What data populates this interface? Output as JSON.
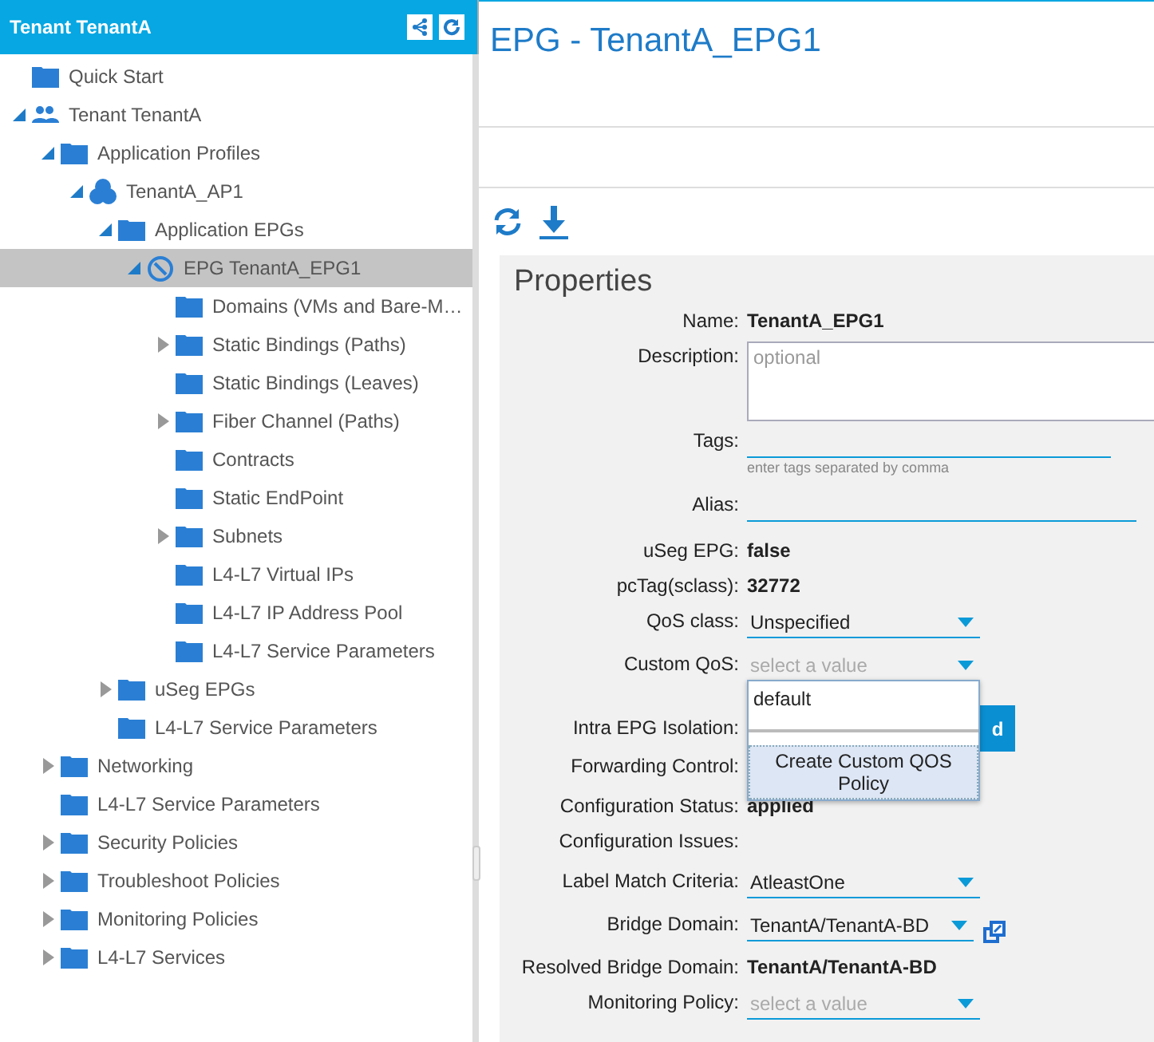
{
  "sidebar": {
    "title": "Tenant TenantA",
    "tree": [
      {
        "label": "Quick Start",
        "kind": "folder",
        "selected": false
      },
      {
        "label": "Tenant TenantA",
        "kind": "tenant",
        "expanded": true,
        "selected": false,
        "children": [
          {
            "label": "Application Profiles",
            "kind": "folder",
            "expanded": true,
            "selected": false,
            "children": [
              {
                "label": "TenantA_AP1",
                "kind": "app-profile",
                "expanded": true,
                "selected": false,
                "children": [
                  {
                    "label": "Application EPGs",
                    "kind": "folder",
                    "expanded": true,
                    "selected": false,
                    "children": [
                      {
                        "label": "EPG TenantA_EPG1",
                        "kind": "epg",
                        "expanded": true,
                        "selected": true,
                        "children": [
                          {
                            "label": "Domains (VMs and Bare-M…",
                            "kind": "folder",
                            "selected": false
                          },
                          {
                            "label": "Static Bindings (Paths)",
                            "kind": "folder",
                            "expanded": false,
                            "selected": false
                          },
                          {
                            "label": "Static Bindings (Leaves)",
                            "kind": "folder",
                            "selected": false
                          },
                          {
                            "label": "Fiber Channel (Paths)",
                            "kind": "folder",
                            "expanded": false,
                            "selected": false
                          },
                          {
                            "label": "Contracts",
                            "kind": "folder",
                            "selected": false
                          },
                          {
                            "label": "Static EndPoint",
                            "kind": "folder",
                            "selected": false
                          },
                          {
                            "label": "Subnets",
                            "kind": "folder",
                            "expanded": false,
                            "selected": false
                          },
                          {
                            "label": "L4-L7 Virtual IPs",
                            "kind": "folder",
                            "selected": false
                          },
                          {
                            "label": "L4-L7 IP Address Pool",
                            "kind": "folder",
                            "selected": false
                          },
                          {
                            "label": "L4-L7 Service Parameters",
                            "kind": "folder",
                            "selected": false
                          }
                        ]
                      }
                    ]
                  },
                  {
                    "label": "uSeg EPGs",
                    "kind": "folder",
                    "expanded": false,
                    "selected": false
                  },
                  {
                    "label": "L4-L7 Service Parameters",
                    "kind": "folder",
                    "selected": false
                  }
                ]
              }
            ]
          },
          {
            "label": "Networking",
            "kind": "folder",
            "expanded": false,
            "selected": false
          },
          {
            "label": "L4-L7 Service Parameters",
            "kind": "folder",
            "selected": false
          },
          {
            "label": "Security Policies",
            "kind": "folder",
            "expanded": false,
            "selected": false
          },
          {
            "label": "Troubleshoot Policies",
            "kind": "folder",
            "expanded": false,
            "selected": false
          },
          {
            "label": "Monitoring Policies",
            "kind": "folder",
            "expanded": false,
            "selected": false
          },
          {
            "label": "L4-L7 Services",
            "kind": "folder",
            "expanded": false,
            "selected": false
          }
        ]
      }
    ]
  },
  "page": {
    "title": "EPG - TenantA_EPG1"
  },
  "properties": {
    "title": "Properties",
    "fields": [
      {
        "label": "Name:",
        "kind": "bold",
        "value": "TenantA_EPG1"
      },
      {
        "label": "Description:",
        "kind": "textarea",
        "placeholder": "optional"
      },
      {
        "label": "Tags:",
        "kind": "tags",
        "hint": "enter tags separated by comma"
      },
      {
        "label": "Alias:",
        "kind": "input"
      },
      {
        "label": "uSeg EPG:",
        "kind": "bold",
        "value": "false"
      },
      {
        "label": "pcTag(sclass):",
        "kind": "bold",
        "value": "32772"
      },
      {
        "label": "QoS class:",
        "kind": "select",
        "value": "Unspecified"
      },
      {
        "label": "Custom QoS:",
        "kind": "select",
        "placeholder": "select a value",
        "menu": {
          "options": [
            "default"
          ],
          "action": "Create Custom QOS Policy"
        }
      },
      {
        "label": "Intra EPG Isolation:",
        "kind": "button",
        "value": "d"
      },
      {
        "label": "Forwarding Control:",
        "kind": "empty"
      },
      {
        "label": "Configuration Status:",
        "kind": "bold",
        "value": "applied"
      },
      {
        "label": "Configuration Issues:",
        "kind": "empty"
      },
      {
        "label": "Label Match Criteria:",
        "kind": "select",
        "value": "AtleastOne"
      },
      {
        "label": "Bridge Domain:",
        "kind": "select",
        "value": "TenantA/TenantA-BD",
        "link": true
      },
      {
        "label": "Resolved Bridge Domain:",
        "kind": "bold",
        "value": "TenantA/TenantA-BD"
      },
      {
        "label": "Monitoring Policy:",
        "kind": "select",
        "placeholder": "select a value"
      }
    ]
  }
}
